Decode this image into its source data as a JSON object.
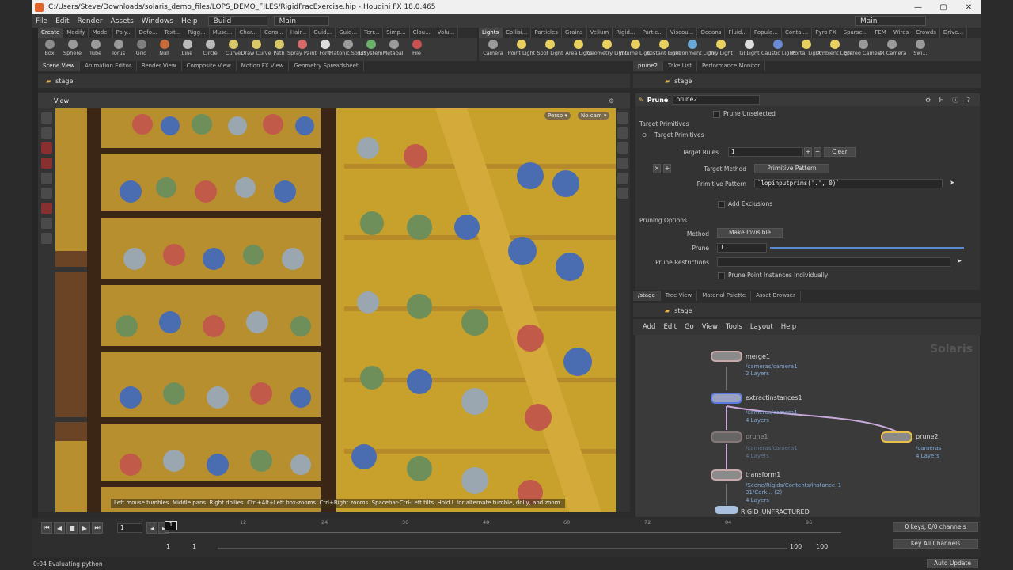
{
  "window": {
    "title": "C:/Users/Steve/Downloads/solaris_demo_files/LOPS_DEMO_FILES/RigidFracExercise.hip - Houdini FX 18.0.465",
    "min": "—",
    "max": "▢",
    "close": "✕"
  },
  "menu": {
    "items": [
      "File",
      "Edit",
      "Render",
      "Assets",
      "Windows",
      "Help"
    ],
    "desktop": "Build",
    "desktop_right": "Main",
    "context": "Main"
  },
  "shelf_left": {
    "tabs": [
      "Create",
      "Modify",
      "Model",
      "Poly...",
      "Defo...",
      "Text...",
      "Rigg...",
      "Musc...",
      "Char...",
      "Cons...",
      "Hair...",
      "Guid...",
      "Guid...",
      "Terr...",
      "Simp...",
      "Clou...",
      "Volu..."
    ],
    "tools": [
      {
        "label": "Box",
        "color": "#8c8c8c"
      },
      {
        "label": "Sphere",
        "color": "#9a9a9a"
      },
      {
        "label": "Tube",
        "color": "#9a9a9a"
      },
      {
        "label": "Torus",
        "color": "#9a9a9a"
      },
      {
        "label": "Grid",
        "color": "#7f7f7f"
      },
      {
        "label": "Null",
        "color": "#c96a3a"
      },
      {
        "label": "Line",
        "color": "#bbbbbb"
      },
      {
        "label": "Circle",
        "color": "#bbbbbb"
      },
      {
        "label": "Curve",
        "color": "#d8c86a"
      },
      {
        "label": "Draw Curve",
        "color": "#d8c86a"
      },
      {
        "label": "Path",
        "color": "#d8c86a"
      },
      {
        "label": "Spray Paint",
        "color": "#d86a6a"
      },
      {
        "label": "Font",
        "color": "#dddddd"
      },
      {
        "label": "Platonic Solids",
        "color": "#9a9a9a"
      },
      {
        "label": "L-System",
        "color": "#6ab06a"
      },
      {
        "label": "Metaball",
        "color": "#9a9a9a"
      },
      {
        "label": "File",
        "color": "#c85050"
      }
    ]
  },
  "shelf_right": {
    "tabs": [
      "Lights",
      "Collisi...",
      "Particles",
      "Grains",
      "Vellum",
      "Rigid...",
      "Partic...",
      "Viscou...",
      "Oceans",
      "Fluid...",
      "Popula...",
      "Contai...",
      "Pyro FX",
      "Sparse...",
      "FEM",
      "Wires",
      "Crowds",
      "Drive..."
    ],
    "tools": [
      {
        "label": "Camera",
        "color": "#9a9a9a"
      },
      {
        "label": "Point Light",
        "color": "#e8d060"
      },
      {
        "label": "Spot Light",
        "color": "#e8d060"
      },
      {
        "label": "Area Light",
        "color": "#e8d060"
      },
      {
        "label": "Geometry Light",
        "color": "#e8d060"
      },
      {
        "label": "Volume Light",
        "color": "#e8d060"
      },
      {
        "label": "Distant Light",
        "color": "#e8d060"
      },
      {
        "label": "Environment Light",
        "color": "#6aa8d8"
      },
      {
        "label": "Sky Light",
        "color": "#e8d060"
      },
      {
        "label": "GI Light",
        "color": "#dddddd"
      },
      {
        "label": "Caustic Light",
        "color": "#6a8ad8"
      },
      {
        "label": "Portal Light",
        "color": "#e8d060"
      },
      {
        "label": "Ambient Light",
        "color": "#e8d060"
      },
      {
        "label": "Stereo Camera",
        "color": "#9a9a9a"
      },
      {
        "label": "VR Camera",
        "color": "#9a9a9a"
      },
      {
        "label": "Swi...",
        "color": "#9a9a9a"
      }
    ]
  },
  "left_pane": {
    "tabs": [
      "Scene View",
      "Animation Editor",
      "Render View",
      "Composite View",
      "Motion FX View",
      "Geometry Spreadsheet"
    ],
    "path": "stage",
    "view_label": "View",
    "persp": "Persp",
    "cam": "No cam",
    "hint": "Left mouse tumbles. Middle pans. Right dollies. Ctrl+Alt+Left box-zooms. Ctrl+Right zooms. Spacebar-Ctrl-Left tilts. Hold L for alternate tumble, dolly, and zoom."
  },
  "param_pane": {
    "tabs": [
      "prune2",
      "Take List",
      "Performance Monitor"
    ],
    "path": "stage",
    "node_type": "Prune",
    "node_name": "prune2",
    "prune_unselected": "Prune Unselected",
    "section_target": "Target Primitives",
    "subsection_target": "Target Primitives",
    "target_rules_label": "Target Rules",
    "target_rules_value": "1",
    "clear": "Clear",
    "target_method_label": "Target Method",
    "target_method_value": "Primitive Pattern",
    "prim_pattern_label": "Primitive Pattern",
    "prim_pattern_value": "`lopinputprims('.', 0)`",
    "add_exclusions": "Add Exclusions",
    "section_pruning": "Pruning Options",
    "method_label": "Method",
    "method_value": "Make Invisible",
    "prune_label": "Prune",
    "prune_value": "1",
    "prune_restrictions_label": "Prune Restrictions",
    "prune_points": "Prune Point Instances Individually"
  },
  "net_pane": {
    "tabs": [
      "/stage",
      "Tree View",
      "Material Palette",
      "Asset Browser"
    ],
    "path": "stage",
    "menu": [
      "Add",
      "Edit",
      "Go",
      "View",
      "Tools",
      "Layout",
      "Help"
    ],
    "watermark": "Solaris",
    "nodes": [
      {
        "name": "merge1",
        "lines": [
          "/cameras/camera1",
          "2 Layers"
        ]
      },
      {
        "name": "extractinstances1",
        "lines": [
          "/cameras/camera1",
          "4 Layers"
        ]
      },
      {
        "name": "prune1",
        "lines": [
          "/cameras/camera1",
          "4 Layers"
        ]
      },
      {
        "name": "prune2",
        "lines": [
          "/cameras",
          "4 Layers"
        ]
      },
      {
        "name": "transform1",
        "lines": [
          "/Scene/Rigids/Contents/instance_1",
          "31/Cork... (2)",
          "4 Layers"
        ]
      },
      {
        "name": "RIGID_UNFRACTURED",
        "lines": []
      }
    ]
  },
  "timeline": {
    "frame": "1",
    "ticks": [
      "12",
      "24",
      "36",
      "48",
      "60",
      "72",
      "84",
      "96"
    ],
    "current": "1",
    "range_start": "1",
    "range_start2": "1",
    "range_end": "100",
    "range_end2": "100",
    "keys": "0 keys, 0/0 channels",
    "key_all": "Key All Channels"
  },
  "status": {
    "text": "0:04 Evaluating python",
    "auto_update": "Auto Update"
  }
}
